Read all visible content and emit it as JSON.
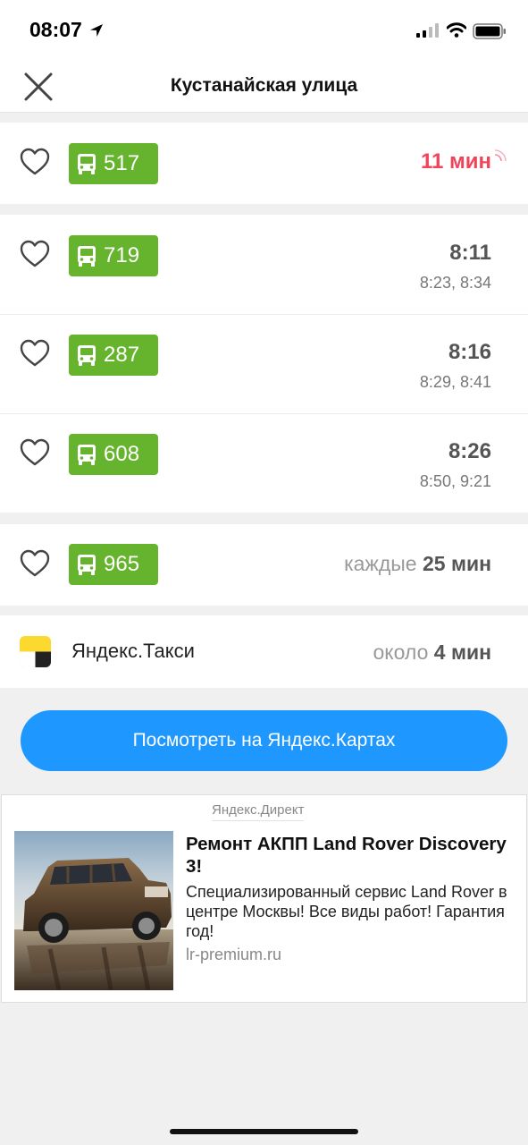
{
  "status_bar": {
    "time": "08:07"
  },
  "nav": {
    "title": "Кустанайская улица"
  },
  "routes_live": [
    {
      "number": "517",
      "arrival": "11 мин"
    }
  ],
  "routes_scheduled": [
    {
      "number": "719",
      "next": "8:11",
      "later": "8:23, 8:34"
    },
    {
      "number": "287",
      "next": "8:16",
      "later": "8:29, 8:41"
    },
    {
      "number": "608",
      "next": "8:26",
      "later": "8:50, 9:21"
    }
  ],
  "routes_interval": [
    {
      "number": "965",
      "prefix": "каждые",
      "interval": "25 мин"
    }
  ],
  "taxi": {
    "name": "Яндекс.Такси",
    "prefix": "около",
    "eta": "4 мин"
  },
  "maps_button": {
    "label": "Посмотреть на Яндекс.Картах"
  },
  "ad": {
    "source": "Яндекс.Директ",
    "title": "Ремонт АКПП Land Rover Discovery 3!",
    "text": "Специализированный сервис Land Rover в центре Москвы! Все виды работ! Гарантия год!",
    "domain": "lr-premium.ru"
  },
  "colors": {
    "badge": "#66b32e",
    "live": "#f0445a",
    "button": "#1e98ff",
    "taxi_yellow": "#fcd92f"
  }
}
